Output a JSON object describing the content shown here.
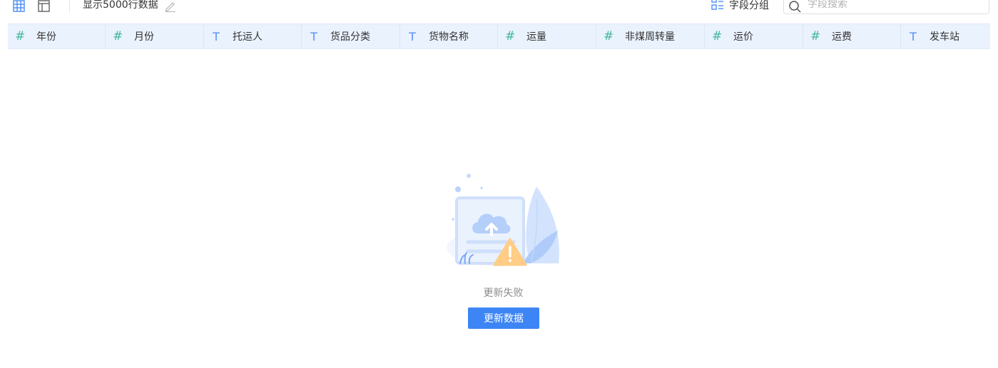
{
  "toolbar": {
    "rows_label": "显示5000行数据",
    "group_label": "字段分组",
    "search_placeholder": "字段搜索",
    "search_value": ""
  },
  "columns": [
    {
      "name": "年份",
      "type": "number"
    },
    {
      "name": "月份",
      "type": "number"
    },
    {
      "name": "托运人",
      "type": "text"
    },
    {
      "name": "货品分类",
      "type": "text"
    },
    {
      "name": "货物名称",
      "type": "text"
    },
    {
      "name": "运量",
      "type": "number"
    },
    {
      "name": "非煤周转量",
      "type": "number"
    },
    {
      "name": "运价",
      "type": "number"
    },
    {
      "name": "运费",
      "type": "number"
    },
    {
      "name": "发车站",
      "type": "text"
    }
  ],
  "type_glyphs": {
    "number": "#",
    "text": "T"
  },
  "empty_state": {
    "message": "更新失败",
    "button_label": "更新数据"
  },
  "colors": {
    "accent": "#3d85f5",
    "header_bg": "#eaf2fe",
    "number_type": "#3fb6a0",
    "text_type": "#5b8ff9"
  }
}
